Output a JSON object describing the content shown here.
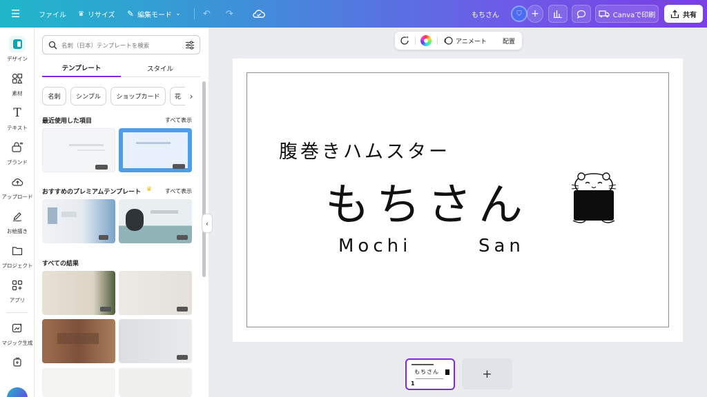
{
  "topbar": {
    "menu_icon": "hamburger-icon",
    "file_label": "ファイル",
    "resize_label": "リサイズ",
    "edit_mode_label": "編集モード",
    "doc_title": "もちさん",
    "print_label": "Canvaで印刷",
    "share_label": "共有",
    "brand_colors": {
      "start": "#1fb7c9",
      "mid": "#6c5ce7",
      "end": "#7b3fe4",
      "accent": "#7d2ae8"
    }
  },
  "rail": {
    "items": [
      {
        "label": "デザイン",
        "icon": "design-icon"
      },
      {
        "label": "素材",
        "icon": "elements-icon"
      },
      {
        "label": "テキスト",
        "icon": "text-icon"
      },
      {
        "label": "ブランド",
        "icon": "brand-icon"
      },
      {
        "label": "アップロード",
        "icon": "upload-icon"
      },
      {
        "label": "お絵描き",
        "icon": "draw-icon"
      },
      {
        "label": "プロジェクト",
        "icon": "folder-icon"
      },
      {
        "label": "アプリ",
        "icon": "apps-icon"
      },
      {
        "label": "マジック生成",
        "icon": "magic-icon"
      },
      {
        "label": "",
        "icon": "more-icon"
      }
    ]
  },
  "panel": {
    "search_placeholder": "名刺（日本）テンプレートを検索",
    "tabs": [
      "テンプレート",
      "スタイル"
    ],
    "chips": [
      "名刺",
      "シンプル",
      "ショップカード",
      "花"
    ],
    "recent_title": "最近使用した項目",
    "recent_see_all": "すべて表示",
    "premium_title": "おすすめのプレミアムテンプレート",
    "premium_see_all": "すべて表示",
    "all_results_title": "すべての結果"
  },
  "floating_toolbar": {
    "animate_label": "アニメート",
    "arrange_label": "配置"
  },
  "card": {
    "subtitle": "腹巻きハムスター",
    "title": "もちさん",
    "roman_first": "Mochi",
    "roman_second": "San"
  },
  "pages": {
    "current_page_number": "1",
    "add_page_symbol": "+"
  }
}
